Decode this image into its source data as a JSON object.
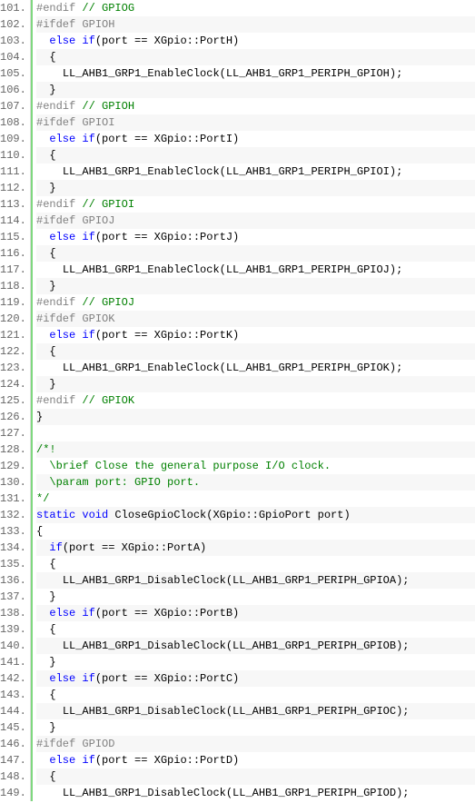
{
  "startLine": 101,
  "lines": [
    {
      "n": 101,
      "alt": false,
      "tokens": [
        {
          "t": "#endif",
          "c": "pp"
        },
        {
          "t": " ",
          "c": ""
        },
        {
          "t": "// GPIOG",
          "c": "cm"
        }
      ],
      "indent": 0
    },
    {
      "n": 102,
      "alt": true,
      "tokens": [
        {
          "t": "#ifdef",
          "c": "pp"
        },
        {
          "t": " GPIOH",
          "c": "pp"
        }
      ],
      "indent": 0
    },
    {
      "n": 103,
      "alt": false,
      "tokens": [
        {
          "t": "else if",
          "c": "kw"
        },
        {
          "t": "(port == XGpio::PortH)",
          "c": ""
        }
      ],
      "indent": 1
    },
    {
      "n": 104,
      "alt": true,
      "tokens": [
        {
          "t": "{",
          "c": ""
        }
      ],
      "indent": 1
    },
    {
      "n": 105,
      "alt": false,
      "tokens": [
        {
          "t": "LL_AHB1_GRP1_EnableClock(LL_AHB1_GRP1_PERIPH_GPIOH);",
          "c": ""
        }
      ],
      "indent": 2
    },
    {
      "n": 106,
      "alt": true,
      "tokens": [
        {
          "t": "}",
          "c": ""
        }
      ],
      "indent": 1
    },
    {
      "n": 107,
      "alt": false,
      "tokens": [
        {
          "t": "#endif",
          "c": "pp"
        },
        {
          "t": " ",
          "c": ""
        },
        {
          "t": "// GPIOH",
          "c": "cm"
        }
      ],
      "indent": 0
    },
    {
      "n": 108,
      "alt": true,
      "tokens": [
        {
          "t": "#ifdef",
          "c": "pp"
        },
        {
          "t": " GPIOI",
          "c": "pp"
        }
      ],
      "indent": 0
    },
    {
      "n": 109,
      "alt": false,
      "tokens": [
        {
          "t": "else if",
          "c": "kw"
        },
        {
          "t": "(port == XGpio::PortI)",
          "c": ""
        }
      ],
      "indent": 1
    },
    {
      "n": 110,
      "alt": true,
      "tokens": [
        {
          "t": "{",
          "c": ""
        }
      ],
      "indent": 1
    },
    {
      "n": 111,
      "alt": false,
      "tokens": [
        {
          "t": "LL_AHB1_GRP1_EnableClock(LL_AHB1_GRP1_PERIPH_GPIOI);",
          "c": ""
        }
      ],
      "indent": 2
    },
    {
      "n": 112,
      "alt": true,
      "tokens": [
        {
          "t": "}",
          "c": ""
        }
      ],
      "indent": 1
    },
    {
      "n": 113,
      "alt": false,
      "tokens": [
        {
          "t": "#endif",
          "c": "pp"
        },
        {
          "t": " ",
          "c": ""
        },
        {
          "t": "// GPIOI",
          "c": "cm"
        }
      ],
      "indent": 0
    },
    {
      "n": 114,
      "alt": true,
      "tokens": [
        {
          "t": "#ifdef",
          "c": "pp"
        },
        {
          "t": " GPIOJ",
          "c": "pp"
        }
      ],
      "indent": 0
    },
    {
      "n": 115,
      "alt": false,
      "tokens": [
        {
          "t": "else if",
          "c": "kw"
        },
        {
          "t": "(port == XGpio::PortJ)",
          "c": ""
        }
      ],
      "indent": 1
    },
    {
      "n": 116,
      "alt": true,
      "tokens": [
        {
          "t": "{",
          "c": ""
        }
      ],
      "indent": 1
    },
    {
      "n": 117,
      "alt": false,
      "tokens": [
        {
          "t": "LL_AHB1_GRP1_EnableClock(LL_AHB1_GRP1_PERIPH_GPIOJ);",
          "c": ""
        }
      ],
      "indent": 2
    },
    {
      "n": 118,
      "alt": true,
      "tokens": [
        {
          "t": "}",
          "c": ""
        }
      ],
      "indent": 1
    },
    {
      "n": 119,
      "alt": false,
      "tokens": [
        {
          "t": "#endif",
          "c": "pp"
        },
        {
          "t": " ",
          "c": ""
        },
        {
          "t": "// GPIOJ",
          "c": "cm"
        }
      ],
      "indent": 0
    },
    {
      "n": 120,
      "alt": true,
      "tokens": [
        {
          "t": "#ifdef",
          "c": "pp"
        },
        {
          "t": " GPIOK",
          "c": "pp"
        }
      ],
      "indent": 0
    },
    {
      "n": 121,
      "alt": false,
      "tokens": [
        {
          "t": "else if",
          "c": "kw"
        },
        {
          "t": "(port == XGpio::PortK)",
          "c": ""
        }
      ],
      "indent": 1
    },
    {
      "n": 122,
      "alt": true,
      "tokens": [
        {
          "t": "{",
          "c": ""
        }
      ],
      "indent": 1
    },
    {
      "n": 123,
      "alt": false,
      "tokens": [
        {
          "t": "LL_AHB1_GRP1_EnableClock(LL_AHB1_GRP1_PERIPH_GPIOK);",
          "c": ""
        }
      ],
      "indent": 2
    },
    {
      "n": 124,
      "alt": true,
      "tokens": [
        {
          "t": "}",
          "c": ""
        }
      ],
      "indent": 1
    },
    {
      "n": 125,
      "alt": false,
      "tokens": [
        {
          "t": "#endif",
          "c": "pp"
        },
        {
          "t": " ",
          "c": ""
        },
        {
          "t": "// GPIOK",
          "c": "cm"
        }
      ],
      "indent": 0
    },
    {
      "n": 126,
      "alt": true,
      "tokens": [
        {
          "t": "}",
          "c": ""
        }
      ],
      "indent": 0
    },
    {
      "n": 127,
      "alt": false,
      "tokens": [],
      "indent": 0
    },
    {
      "n": 128,
      "alt": true,
      "tokens": [
        {
          "t": "/*!",
          "c": "cm"
        }
      ],
      "indent": 0
    },
    {
      "n": 129,
      "alt": false,
      "tokens": [
        {
          "t": "  \\brief Close the general purpose I/O clock.",
          "c": "cm"
        }
      ],
      "indent": 0
    },
    {
      "n": 130,
      "alt": true,
      "tokens": [
        {
          "t": "  \\param port: GPIO port.",
          "c": "cm"
        }
      ],
      "indent": 0
    },
    {
      "n": 131,
      "alt": false,
      "tokens": [
        {
          "t": "*/",
          "c": "cm"
        }
      ],
      "indent": 0
    },
    {
      "n": 132,
      "alt": true,
      "tokens": [
        {
          "t": "static void",
          "c": "kw"
        },
        {
          "t": " CloseGpioClock(XGpio::GpioPort port)",
          "c": ""
        }
      ],
      "indent": 0
    },
    {
      "n": 133,
      "alt": false,
      "tokens": [
        {
          "t": "{",
          "c": ""
        }
      ],
      "indent": 0
    },
    {
      "n": 134,
      "alt": true,
      "tokens": [
        {
          "t": "if",
          "c": "kw"
        },
        {
          "t": "(port == XGpio::PortA)",
          "c": ""
        }
      ],
      "indent": 1
    },
    {
      "n": 135,
      "alt": false,
      "tokens": [
        {
          "t": "{",
          "c": ""
        }
      ],
      "indent": 1
    },
    {
      "n": 136,
      "alt": true,
      "tokens": [
        {
          "t": "LL_AHB1_GRP1_DisableClock(LL_AHB1_GRP1_PERIPH_GPIOA);",
          "c": ""
        }
      ],
      "indent": 2
    },
    {
      "n": 137,
      "alt": false,
      "tokens": [
        {
          "t": "}",
          "c": ""
        }
      ],
      "indent": 1
    },
    {
      "n": 138,
      "alt": true,
      "tokens": [
        {
          "t": "else if",
          "c": "kw"
        },
        {
          "t": "(port == XGpio::PortB)",
          "c": ""
        }
      ],
      "indent": 1
    },
    {
      "n": 139,
      "alt": false,
      "tokens": [
        {
          "t": "{",
          "c": ""
        }
      ],
      "indent": 1
    },
    {
      "n": 140,
      "alt": true,
      "tokens": [
        {
          "t": "LL_AHB1_GRP1_DisableClock(LL_AHB1_GRP1_PERIPH_GPIOB);",
          "c": ""
        }
      ],
      "indent": 2
    },
    {
      "n": 141,
      "alt": false,
      "tokens": [
        {
          "t": "}",
          "c": ""
        }
      ],
      "indent": 1
    },
    {
      "n": 142,
      "alt": true,
      "tokens": [
        {
          "t": "else if",
          "c": "kw"
        },
        {
          "t": "(port == XGpio::PortC)",
          "c": ""
        }
      ],
      "indent": 1
    },
    {
      "n": 143,
      "alt": false,
      "tokens": [
        {
          "t": "{",
          "c": ""
        }
      ],
      "indent": 1
    },
    {
      "n": 144,
      "alt": true,
      "tokens": [
        {
          "t": "LL_AHB1_GRP1_DisableClock(LL_AHB1_GRP1_PERIPH_GPIOC);",
          "c": ""
        }
      ],
      "indent": 2
    },
    {
      "n": 145,
      "alt": false,
      "tokens": [
        {
          "t": "}",
          "c": ""
        }
      ],
      "indent": 1
    },
    {
      "n": 146,
      "alt": true,
      "tokens": [
        {
          "t": "#ifdef",
          "c": "pp"
        },
        {
          "t": " GPIOD",
          "c": "pp"
        }
      ],
      "indent": 0
    },
    {
      "n": 147,
      "alt": false,
      "tokens": [
        {
          "t": "else if",
          "c": "kw"
        },
        {
          "t": "(port == XGpio::PortD)",
          "c": ""
        }
      ],
      "indent": 1
    },
    {
      "n": 148,
      "alt": true,
      "tokens": [
        {
          "t": "{",
          "c": ""
        }
      ],
      "indent": 1
    },
    {
      "n": 149,
      "alt": false,
      "tokens": [
        {
          "t": "LL_AHB1_GRP1_DisableClock(LL_AHB1_GRP1_PERIPH_GPIOD);",
          "c": ""
        }
      ],
      "indent": 2
    }
  ]
}
